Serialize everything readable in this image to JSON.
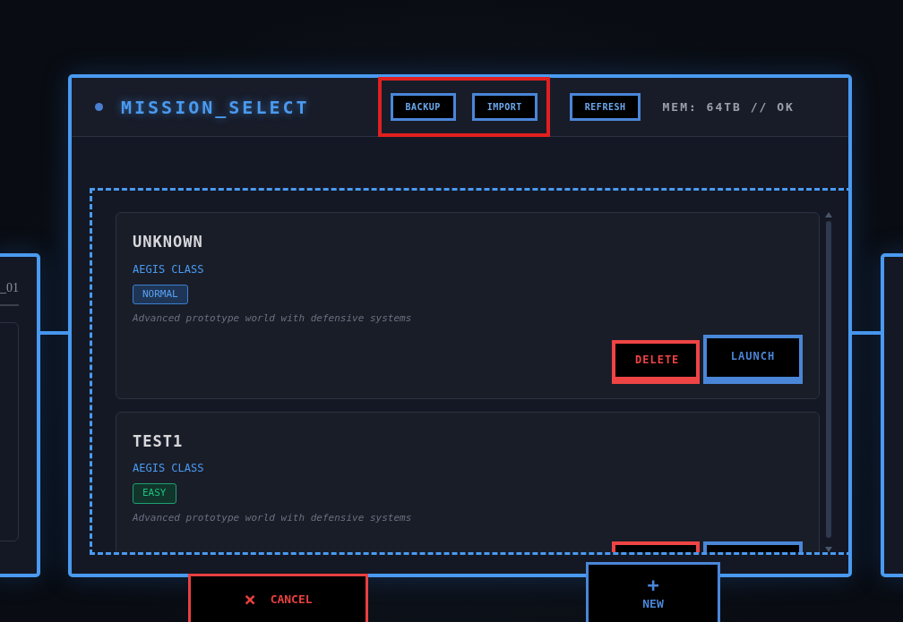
{
  "panel": {
    "title": "MISSION_SELECT",
    "status": "MEM: 64TB // OK"
  },
  "header_buttons": [
    {
      "label": "BACKUP",
      "highlighted": true
    },
    {
      "label": "IMPORT",
      "highlighted": true
    },
    {
      "label": "REFRESH",
      "highlighted": false
    }
  ],
  "worlds": [
    {
      "name": "UNKNOWN",
      "class": "AEGIS CLASS",
      "difficulty": "NORMAL",
      "kind": "normal",
      "description": "Advanced prototype world with defensive systems",
      "actions": [
        {
          "kind": "delete",
          "label": "DELETE"
        },
        {
          "kind": "launch",
          "label": "LAUNCH"
        }
      ]
    },
    {
      "name": "TEST1",
      "class": "AEGIS CLASS",
      "difficulty": "EASY",
      "kind": "easy",
      "description": "Advanced prototype world with defensive systems",
      "actions": [
        {
          "kind": "delete"
        },
        {
          "kind": "launch"
        }
      ]
    }
  ],
  "left_panel": {
    "title": "_01"
  },
  "footer_buttons": [
    {
      "label": "CANCEL",
      "icon": "×",
      "kind": "cancel"
    },
    {
      "label": "NEW",
      "icon": "+",
      "kind": "new"
    }
  ]
}
